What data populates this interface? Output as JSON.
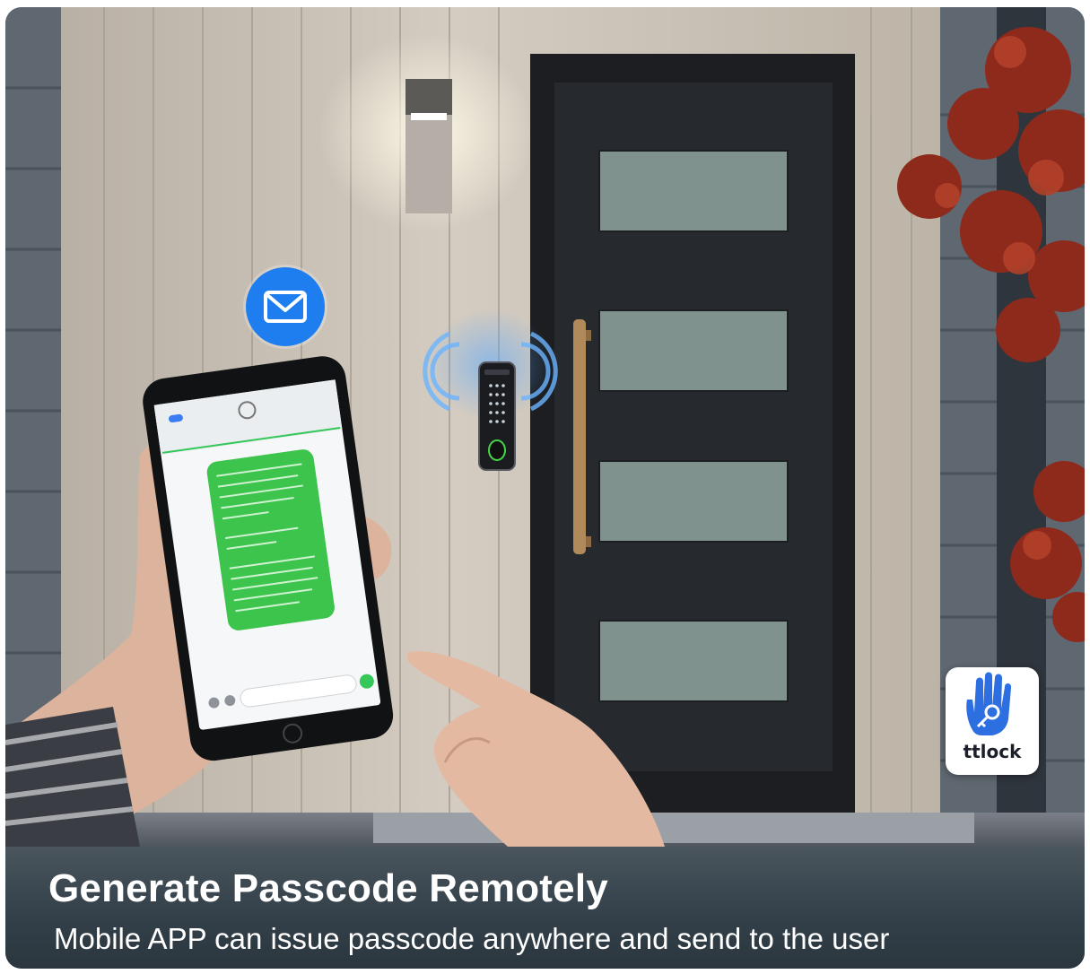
{
  "caption": {
    "title": "Generate Passcode Remotely",
    "subtitle": "Mobile APP can issue passcode anywhere and send to the user"
  },
  "app_badge": {
    "label": "ttlock",
    "icon": "hand-key-icon",
    "color": "#2d6fe0"
  },
  "scene_icons": [
    "mail-icon",
    "wireless-signal-icon",
    "smart-lock-icon"
  ],
  "colors": {
    "door": "#24272d",
    "wall": "#c7bfb4",
    "banner": "#34414a",
    "message_bubble": "#3cc44c",
    "mail_accent": "#1e7ef0",
    "foliage": "#8e2a1c"
  }
}
